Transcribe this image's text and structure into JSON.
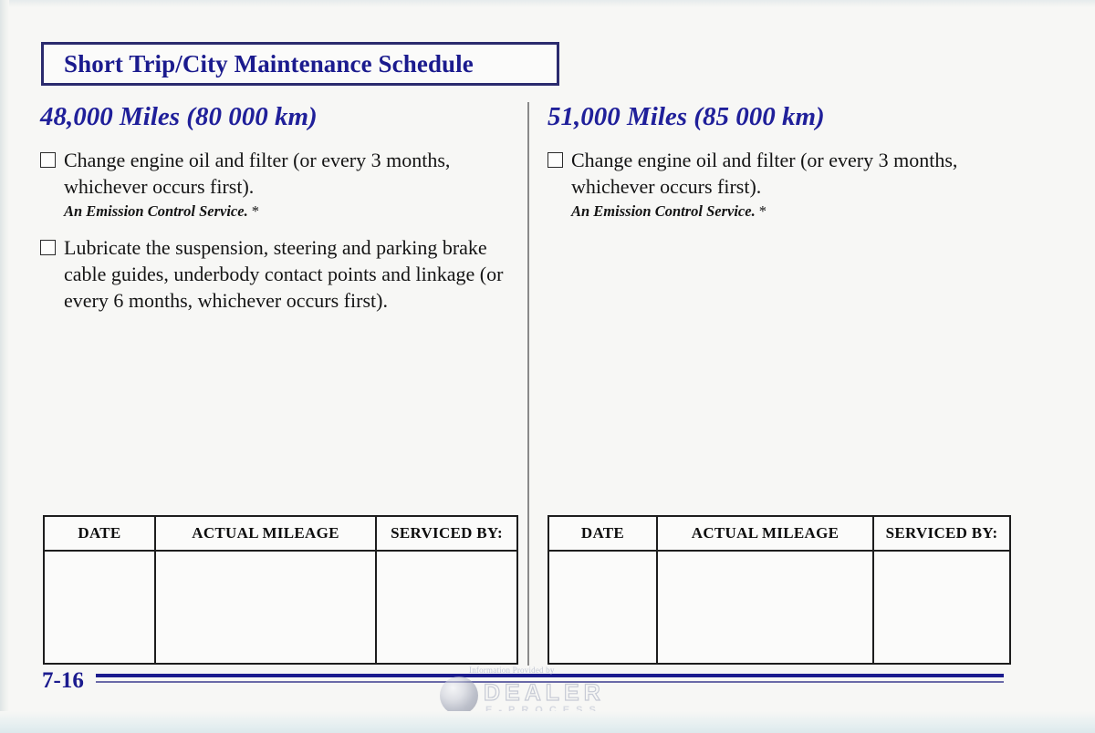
{
  "document": {
    "title": "Short Trip/City Maintenance Schedule",
    "page_number": "7-16"
  },
  "columns": [
    {
      "heading": "48,000 Miles (80 000 km)",
      "tasks": [
        {
          "checkbox": "unchecked",
          "text": "Change engine oil and filter (or every 3 months, whichever occurs first).",
          "note": "An Emission Control Service.",
          "note_marker": "*"
        },
        {
          "checkbox": "unchecked",
          "text": "Lubricate the suspension, steering and parking brake cable guides, underbody contact points and linkage (or every 6 months, whichever occurs first).",
          "note": "",
          "note_marker": ""
        }
      ],
      "record_table": {
        "headers": [
          "DATE",
          "ACTUAL MILEAGE",
          "SERVICED BY:"
        ],
        "rows": [
          [
            "",
            "",
            ""
          ]
        ]
      }
    },
    {
      "heading": "51,000 Miles (85 000 km)",
      "tasks": [
        {
          "checkbox": "unchecked",
          "text": "Change engine oil and filter (or every 3 months, whichever occurs first).",
          "note": "An Emission Control Service.",
          "note_marker": "*"
        }
      ],
      "record_table": {
        "headers": [
          "DATE",
          "ACTUAL MILEAGE",
          "SERVICED BY:"
        ],
        "rows": [
          [
            "",
            "",
            ""
          ]
        ]
      }
    }
  ],
  "watermark": {
    "caption": "Information Provided by",
    "brand": "DEALER",
    "subbrand": "E-PROCESS"
  },
  "colors": {
    "heading_blue": "#20209a",
    "title_blue": "#1b1b8e",
    "title_border": "#2b2b6e",
    "body_text": "#141414",
    "page_background": "#f7f7f5",
    "rule_blue": "#1b1b8e"
  }
}
